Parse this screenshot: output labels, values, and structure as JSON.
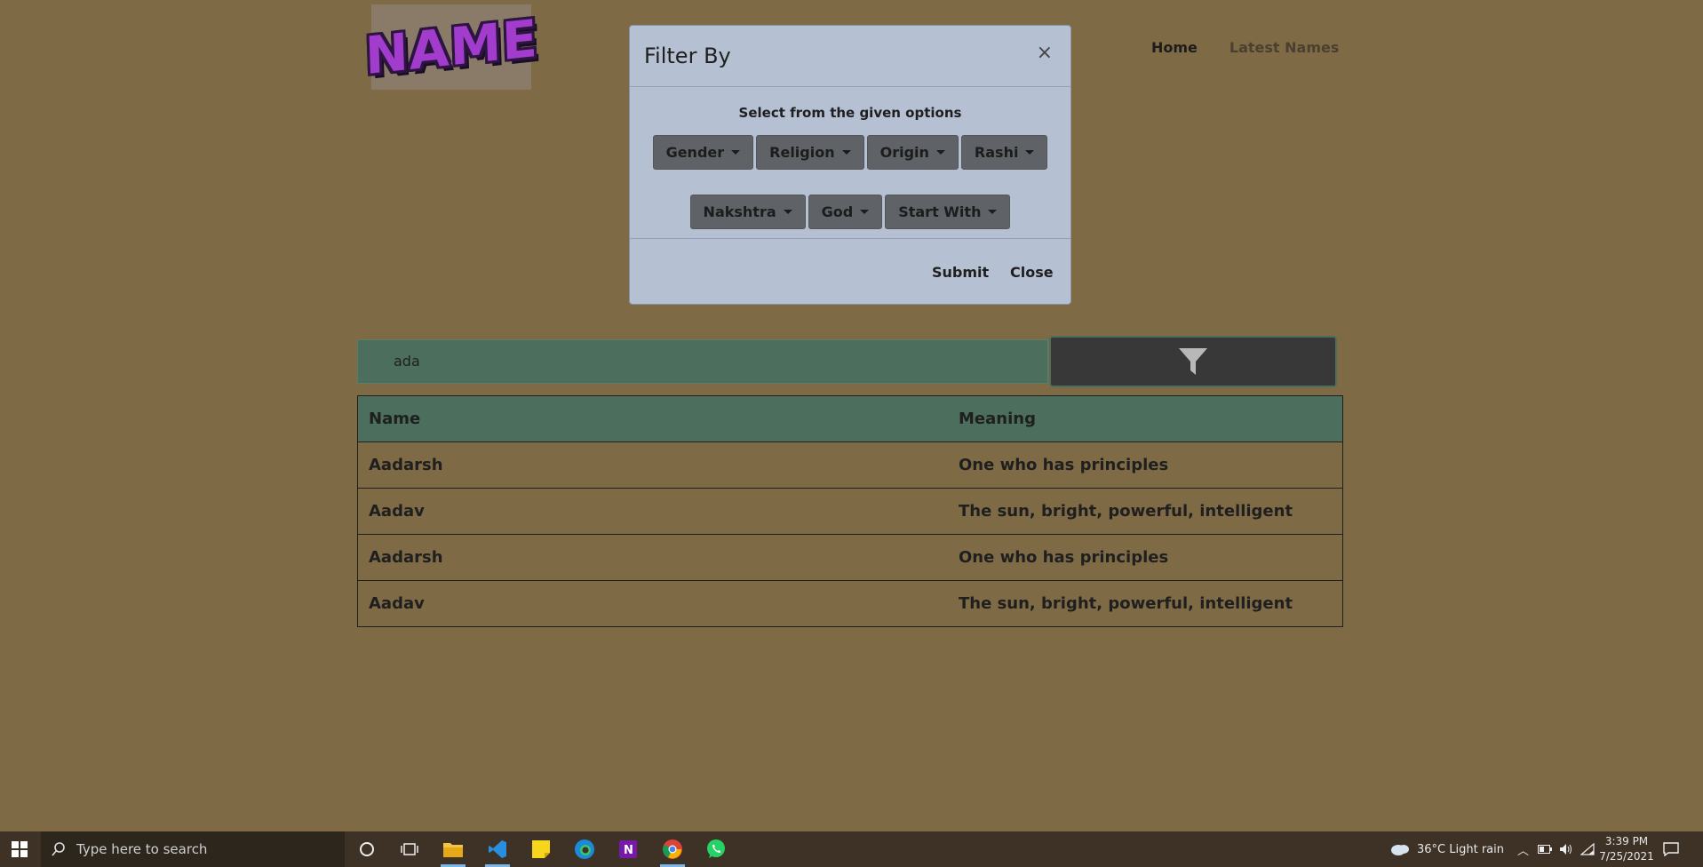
{
  "logo": {
    "text": "NAME"
  },
  "nav": {
    "home": "Home",
    "latest": "Latest Names"
  },
  "search": {
    "value": "ada"
  },
  "table": {
    "headers": [
      "Name",
      "Meaning"
    ],
    "rows": [
      [
        "Aadarsh",
        "One who has principles"
      ],
      [
        "Aadav",
        "The sun, bright, powerful, intelligent"
      ],
      [
        "Aadarsh",
        "One who has principles"
      ],
      [
        "Aadav",
        "The sun, bright, powerful, intelligent"
      ]
    ]
  },
  "modal": {
    "title": "Filter By",
    "close_x": "×",
    "subtitle": "Select from the given options",
    "dropdowns_row1": [
      "Gender",
      "Religion",
      "Origin",
      "Rashi"
    ],
    "dropdowns_row2": [
      "Nakshtra",
      "God",
      "Start With"
    ],
    "submit": "Submit",
    "close": "Close"
  },
  "taskbar": {
    "search_placeholder": "Type here to search",
    "weather": "36°C  Light rain",
    "time": "3:39 PM",
    "date": "7/25/2021"
  }
}
